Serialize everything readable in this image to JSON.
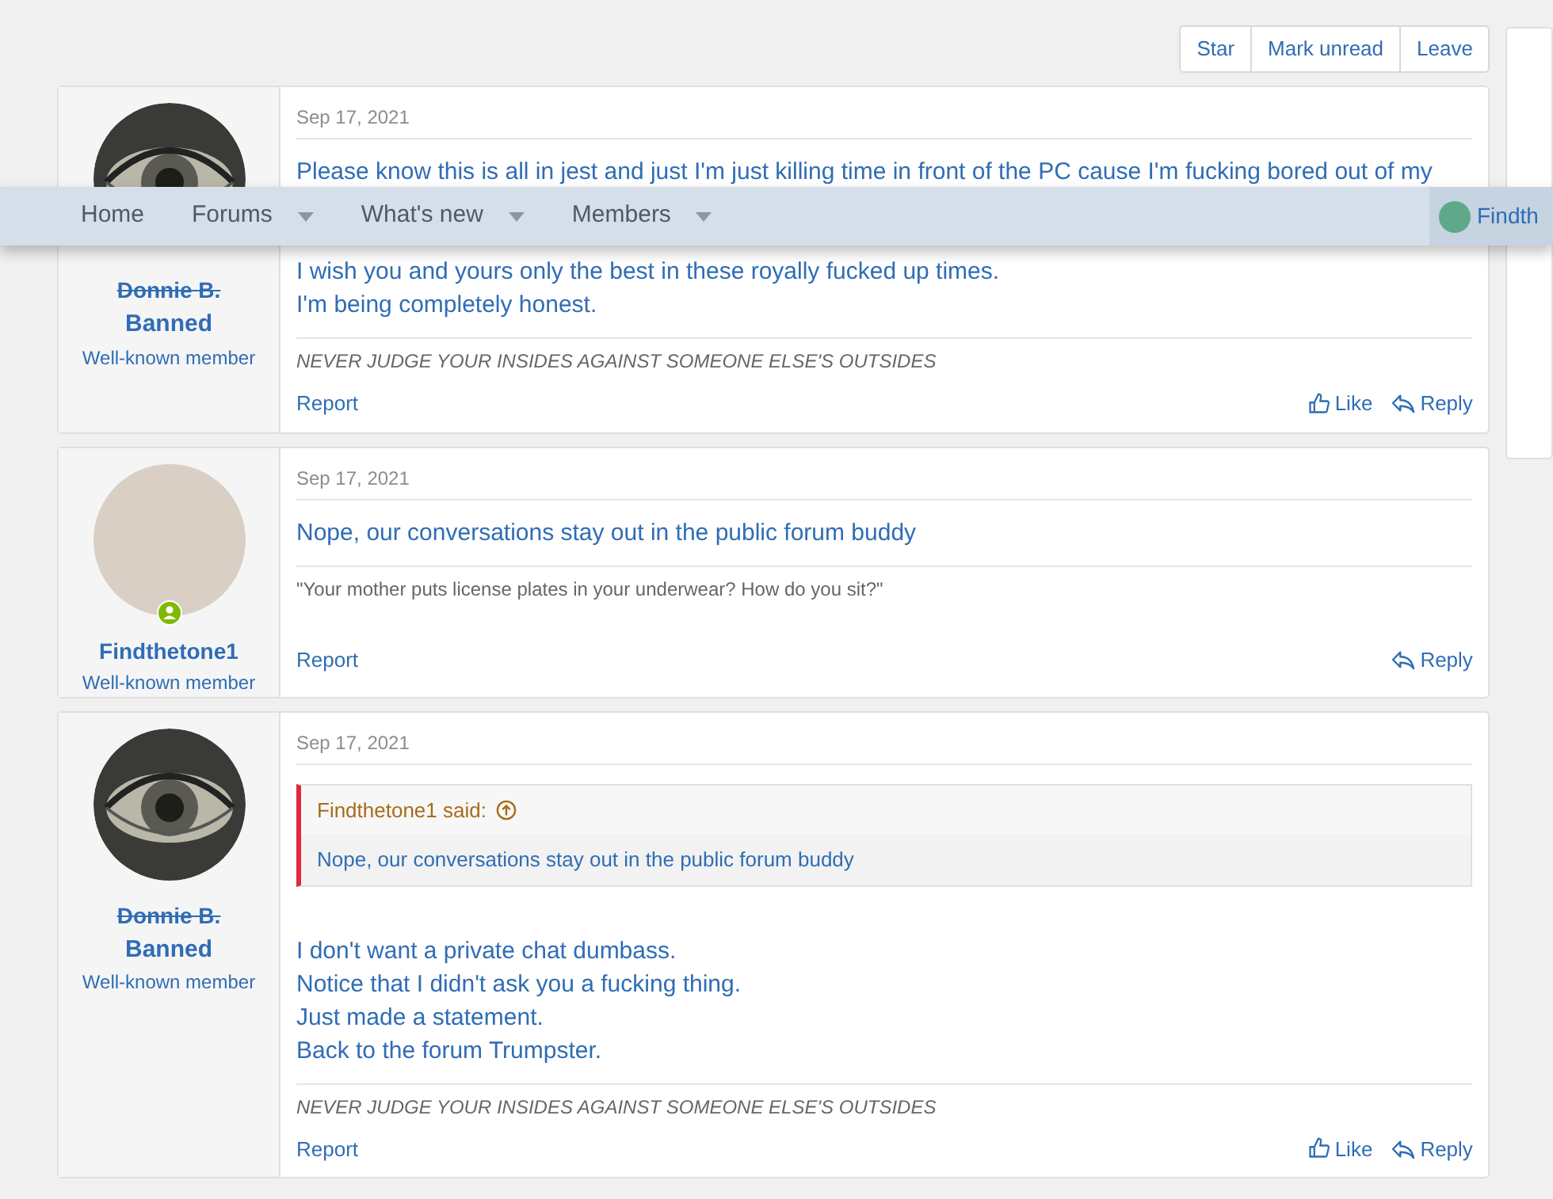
{
  "thread_actions": [
    "Star",
    "Mark unread",
    "Leave"
  ],
  "nav": {
    "items": [
      {
        "label": "Home",
        "has_menu": false
      },
      {
        "label": "Forums",
        "has_menu": true
      },
      {
        "label": "What's new",
        "has_menu": true
      },
      {
        "label": "Members",
        "has_menu": true
      }
    ],
    "user": "Findth"
  },
  "posts": [
    {
      "date": "Sep 17, 2021",
      "author": {
        "name": "Donnie B.",
        "struck": true,
        "banner": "Banned",
        "title": "Well-known member",
        "avatar": {
          "kind": "eye"
        },
        "online": false
      },
      "body_before": [
        "Please know this is all in jest and just I'm just killing time in front of the PC cause I'm fucking bored out of my"
      ],
      "body": [
        "I wish you and yours only the best in these royally fucked up times.",
        "I'm being completely honest."
      ],
      "signature": {
        "text": "NEVER JUDGE YOUR INSIDES AGAINST SOMEONE ELSE'S OUTSIDES",
        "italic": true
      },
      "actions": {
        "report": "Report",
        "like": "Like",
        "reply": "Reply"
      }
    },
    {
      "date": "Sep 17, 2021",
      "author": {
        "name": "Findthetone1",
        "struck": false,
        "title": "Well-known member",
        "avatar": {
          "kind": "photo"
        },
        "online": true
      },
      "body": [
        "Nope, our conversations stay out in the public forum buddy"
      ],
      "signature": {
        "text": "\"Your mother puts license plates in your underwear? How do you sit?\"",
        "italic": false
      },
      "actions": {
        "report": "Report",
        "reply": "Reply"
      }
    },
    {
      "date": "Sep 17, 2021",
      "author": {
        "name": "Donnie B.",
        "struck": true,
        "banner": "Banned",
        "title": "Well-known member",
        "avatar": {
          "kind": "eye"
        },
        "online": false
      },
      "quote": {
        "author": "Findthetone1 said:",
        "text": "Nope, our conversations stay out in the public forum buddy"
      },
      "body": [
        "I don't want a private chat dumbass.",
        "Notice that I didn't ask you a fucking thing.",
        "Just made a statement.",
        "Back to the forum Trumpster."
      ],
      "signature": {
        "text": "NEVER JUDGE YOUR INSIDES AGAINST SOMEONE ELSE'S OUTSIDES",
        "italic": true
      },
      "actions": {
        "report": "Report",
        "like": "Like",
        "reply": "Reply"
      }
    }
  ]
}
